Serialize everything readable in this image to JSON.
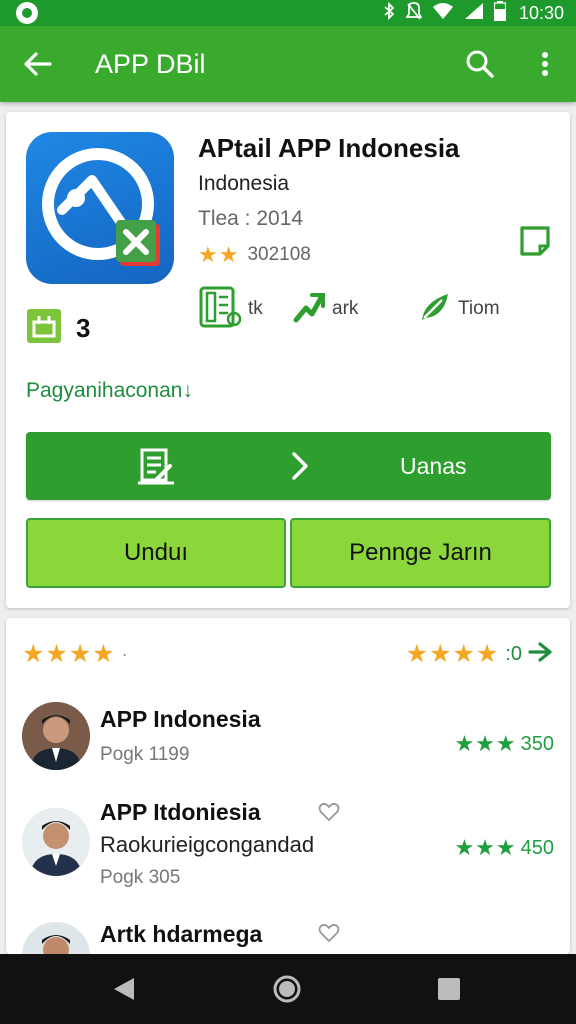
{
  "status_bar": {
    "time": "10:30"
  },
  "app_bar": {
    "title": "APP DBil"
  },
  "app": {
    "name": "APtail APP Indonesia",
    "country": "Indonesia",
    "year": "Tlea : 2014",
    "rating_count": "302108",
    "version": "3",
    "stats": [
      {
        "label": "tk",
        "icon": "document-icon"
      },
      {
        "label": "ark",
        "icon": "arrow-icon"
      },
      {
        "label": "Tiom",
        "icon": "leaf-icon"
      }
    ],
    "section_link": "Pagyanihaconan"
  },
  "buttons": {
    "primary": "Uanas",
    "unduh": "Unduı",
    "peng": "Penngе Jarın"
  },
  "ratings_header": {
    "left_stars": "★★★★",
    "right_stars": "★★★★",
    "right_value": ":0"
  },
  "reviews": [
    {
      "name": "APP Indonesia",
      "subtitle": "",
      "meta": "Pogk 1199",
      "stars": "★★★",
      "value": "350"
    },
    {
      "name": "APP Itdoniesia",
      "subtitle": "Raokurieigcongandad",
      "meta": "Pogk 305",
      "stars": "★★★",
      "value": "450"
    },
    {
      "name": "Artk hdarmega",
      "subtitle": "",
      "meta": "",
      "stars": "",
      "value": ""
    }
  ],
  "colors": {
    "status_bar": "#1e9a2c",
    "app_bar": "#3aaa2e",
    "primary_button": "#2e9e2e",
    "secondary_button": "#8bd63a",
    "star": "#f5a623",
    "green_text": "#1e8e3e"
  }
}
